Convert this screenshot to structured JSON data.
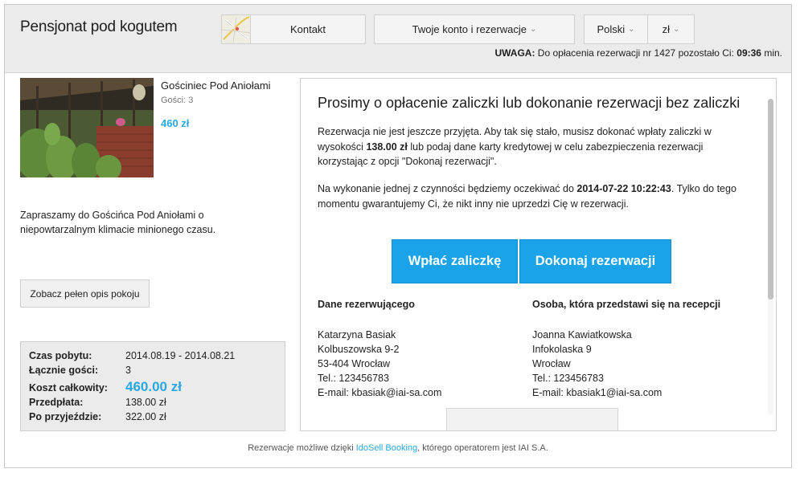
{
  "header": {
    "site_title": "Pensjonat pod kogutem",
    "nav_contact": "Kontakt",
    "nav_account": "Twoje konto i rezerwacje",
    "nav_language": "Polski",
    "nav_currency": "zł",
    "warning_label": "UWAGA:",
    "warning_text": " Do opłacenia rezerwacji nr 1427 pozostało Ci: ",
    "warning_time": "09:36",
    "warning_unit": " min."
  },
  "room": {
    "name": "Gościniec Pod Aniołami",
    "guests": "Gości: 3",
    "price": "460 zł",
    "description": "Zapraszamy do Gościńca Pod Aniołami o niepowtarzalnym klimacie minionego czasu.",
    "full_desc_button": "Zobacz pełen opis pokoju"
  },
  "summary": {
    "rows": [
      {
        "key": "Czas pobytu:",
        "value": "2014.08.19 - 2014.08.21"
      },
      {
        "key": "Łącznie gości:",
        "value": "3"
      },
      {
        "key": "Koszt całkowity:",
        "value": "460.00 zł"
      },
      {
        "key": "Przedpłata:",
        "value": "138.00 zł"
      },
      {
        "key": "Po przyjeździe:",
        "value": "322.00 zł"
      }
    ]
  },
  "panel": {
    "title": "Prosimy o opłacenie zaliczki lub dokonanie rezerwacji bez zaliczki",
    "para1_a": "Rezerwacja nie jest jeszcze przyjęta. Aby tak się stało, musisz dokonać wpłaty zaliczki w wysokości ",
    "para1_amount": "138.00 zł",
    "para1_b": " lub podaj dane karty kredytowej w celu zabezpieczenia rezerwacji korzystając z opcji \"Dokonaj rezerwacji\".",
    "para2_a": "Na wykonanie jednej z czynności będziemy oczekiwać do ",
    "para2_date": "2014-07-22 10:22:43",
    "para2_b": ". Tylko do tego momentu gwarantujemy Ci, że nikt inny nie uprzedzi Cię w rezerwacji.",
    "btn_deposit": "Wpłać zaliczkę",
    "btn_reserve": "Dokonaj rezerwacji",
    "booker": {
      "heading": "Dane rezerwującego",
      "lines": [
        "Katarzyna Basiak",
        "Kolbuszowska 9-2",
        "53-404 Wrocław",
        "Tel.: 123456783",
        "E-mail: kbasiak@iai-sa.com"
      ]
    },
    "guest": {
      "heading": "Osoba, która przedstawi się na recepcji",
      "lines": [
        "Joanna Kawiatkowska",
        "Infokolaska 9",
        "Wrocław",
        "Tel.: 123456783",
        "E-mail: kbasiak1@iai-sa.com"
      ]
    }
  },
  "footer": {
    "text_a": "Rezerwacje możliwe dzięki ",
    "link": "IdoSell Booking",
    "text_b": ", którego operatorem jest IAI S.A."
  }
}
